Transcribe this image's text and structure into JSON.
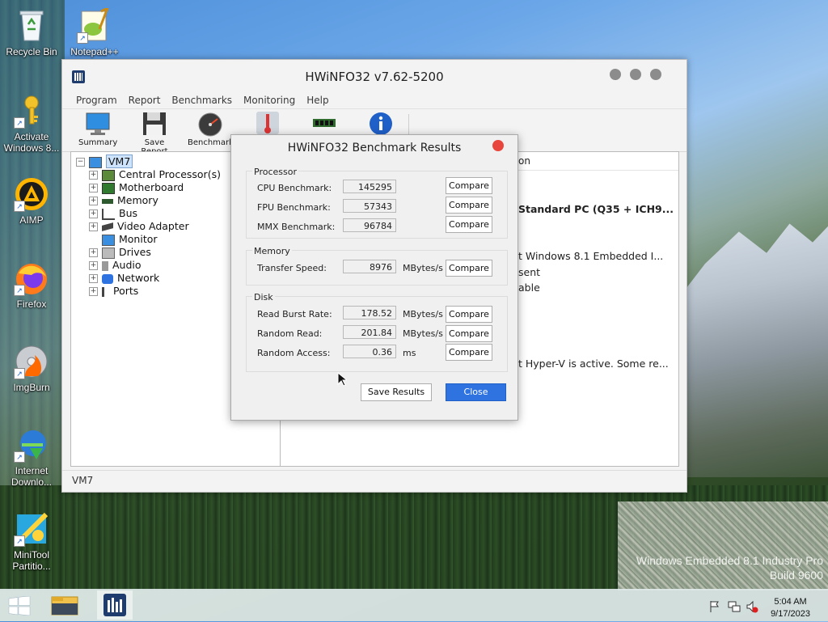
{
  "desktop": {
    "icons": [
      {
        "label": "Recycle Bin"
      },
      {
        "label": "Notepad++"
      },
      {
        "label": "Activate Windows 8..."
      },
      {
        "label": "AIMP"
      },
      {
        "label": "Firefox"
      },
      {
        "label": "ImgBurn"
      },
      {
        "label": "Internet Downlo..."
      },
      {
        "label": "MiniTool Partitio..."
      }
    ],
    "watermark_line1": "Windows Embedded 8.1 Industry Pro",
    "watermark_line2": "Build 9600"
  },
  "window": {
    "title": "HWiNFO32 v7.62-5200",
    "menu": [
      "Program",
      "Report",
      "Benchmarks",
      "Monitoring",
      "Help"
    ],
    "toolbar": [
      {
        "label": "Summary",
        "icon": "monitor-icon"
      },
      {
        "label": "Save Report",
        "icon": "floppy-icon"
      },
      {
        "label": "Benchmark",
        "icon": "gauge-icon"
      },
      {
        "label": "",
        "icon": "thermometer-icon"
      },
      {
        "label": "",
        "icon": "memory-module-icon"
      },
      {
        "label": "",
        "icon": "info-icon"
      }
    ],
    "tree": {
      "root": "VM7",
      "items": [
        "Central Processor(s)",
        "Motherboard",
        "Memory",
        "Bus",
        "Video Adapter",
        "Monitor",
        "Drives",
        "Audio",
        "Network",
        "Ports"
      ]
    },
    "right_pane": {
      "header_col": "on",
      "line1": "Standard PC (Q35 + ICH9...",
      "line2": "t Windows 8.1 Embedded I...",
      "line3": "sent",
      "line4": "able",
      "line5": "t Hyper-V is active. Some re..."
    },
    "status": "VM7"
  },
  "dialog": {
    "title": "HWiNFO32 Benchmark Results",
    "processor": {
      "label": "Processor",
      "rows": [
        {
          "label": "CPU Benchmark:",
          "value": "145295",
          "compare": "Compare"
        },
        {
          "label": "FPU Benchmark:",
          "value": "57343",
          "compare": "Compare"
        },
        {
          "label": "MMX Benchmark:",
          "value": "96784",
          "compare": "Compare"
        }
      ]
    },
    "memory": {
      "label": "Memory",
      "rows": [
        {
          "label": "Transfer Speed:",
          "value": "8976",
          "unit": "MBytes/s",
          "compare": "Compare"
        }
      ]
    },
    "disk": {
      "label": "Disk",
      "rows": [
        {
          "label": "Read Burst Rate:",
          "value": "178.52",
          "unit": "MBytes/s",
          "compare": "Compare"
        },
        {
          "label": "Random Read:",
          "value": "201.84",
          "unit": "MBytes/s",
          "compare": "Compare"
        },
        {
          "label": "Random Access:",
          "value": "0.36",
          "unit": "ms",
          "compare": "Compare"
        }
      ]
    },
    "save_label": "Save Results",
    "close_label": "Close"
  },
  "taskbar": {
    "time": "5:04 AM",
    "date": "9/17/2023"
  },
  "colors": {
    "accent": "#2f73e0",
    "dialog_close": "#e8463d"
  }
}
